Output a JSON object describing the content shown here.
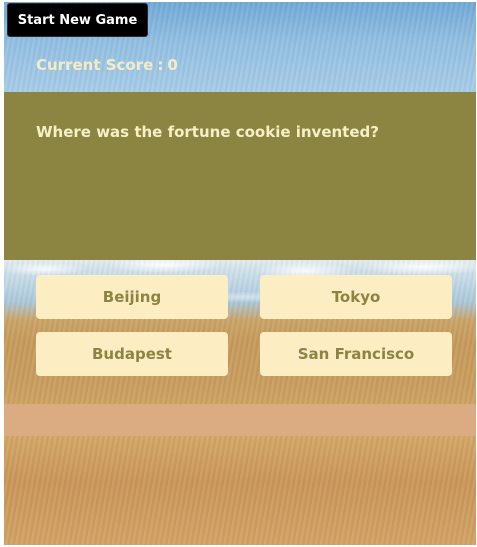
{
  "header": {
    "start_button_label": "Start New Game",
    "score_label": "Current Score",
    "score_separator": ":",
    "score_value": "0"
  },
  "question": {
    "text": "Where was the fortune cookie invented?"
  },
  "answers": [
    {
      "label": "Beijing"
    },
    {
      "label": "Tokyo"
    },
    {
      "label": "Budapest"
    },
    {
      "label": "San Francisco"
    }
  ],
  "colors": {
    "question_panel": "#8b8541",
    "answer_button_bg": "#fcedc3",
    "answer_button_text": "#8b8541",
    "feedback_bar": "#dbab82",
    "start_button_bg": "#000000"
  }
}
